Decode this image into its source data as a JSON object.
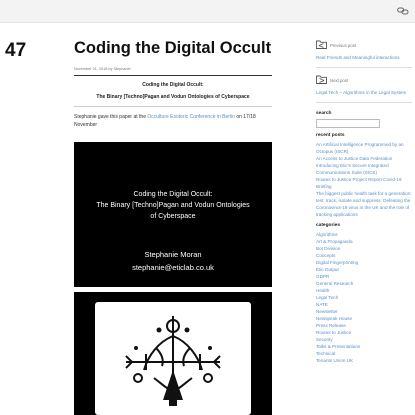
{
  "post": {
    "number": "47",
    "title": "Coding the Digital Occult",
    "meta": "November 21, 2018 by Stephanie",
    "subtitle_line1": "Coding the Digital Occult:",
    "subtitle_line2": "The Binary [Techno]Pagan and Vodun Ontologies of Cyberspace",
    "intro_before": "Stephanie gave this paper at the ",
    "intro_link": "Occulture Esoteric Conference in Berlin",
    "intro_after": " on 17/18 November"
  },
  "slide1": {
    "line1": "Coding the Digital Occult:",
    "line2": "The Binary [Techno]Pagan and Vodun Ontologies",
    "line3": "of Cyberspace",
    "author": "Stephanie Moran",
    "email": "stephanie@eticlab.co.uk"
  },
  "sidebar": {
    "prev_label": "Previous post",
    "prev_title": "Real Friends and Meaningful interactions",
    "next_label": "Next post",
    "next_title": "Legal Tech – Algorithms in the Legal System",
    "search_heading": "search",
    "search_placeholder": "",
    "recent_heading": "recent posts",
    "recent_posts": [
      "An Artificial Intelligence Programmed by an Octopus (ISCR)",
      "An Access to Justice Data Federation",
      "Introducing Etic's Secure Integrated Communications Suite (SICS)",
      "Routes to Justice Project Report Covid-19 Briefing",
      "The biggest public health task for a generation: test, track, isolate and suppress. Defeating the Coronavirus-19 virus in the UK and the role of tracking applications"
    ],
    "categories_heading": "categories",
    "categories": [
      "Algorithms",
      "Art & Propaganda",
      "Bot Division",
      "Concepts",
      "Digital Fingerprinting",
      "Etic Output",
      "GDPR",
      "General Research",
      "Health",
      "Legal Tech",
      "NATE",
      "Newsletter",
      "Newspeak House",
      "Press Release",
      "Routes to Justice",
      "Security",
      "Talks & Presentations",
      "Technical",
      "Tenants Union UK"
    ]
  }
}
